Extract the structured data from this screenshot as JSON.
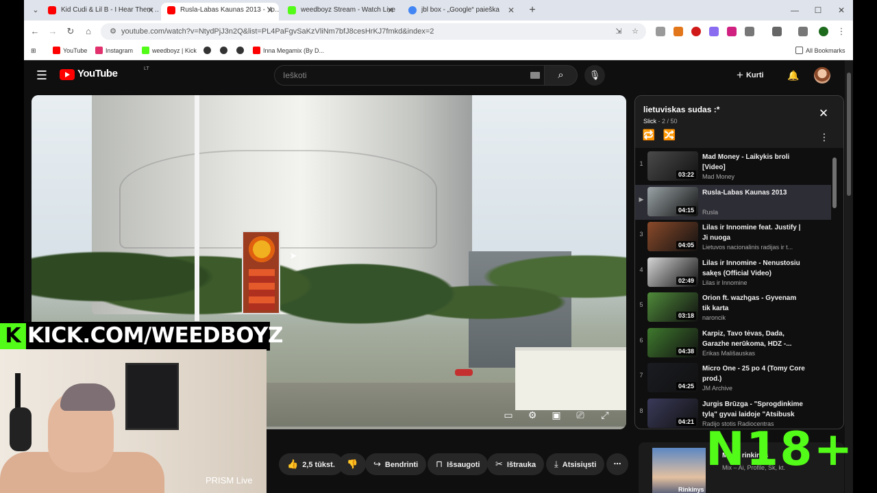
{
  "browser": {
    "tabs": [
      {
        "title": "Kid Cudi & Lil B - I Hear Them Calling",
        "favicon": "youtube-icon",
        "color": "#ff0000",
        "active": false
      },
      {
        "title": "Rusla-Labas Kaunas 2013 - YouTube",
        "favicon": "youtube-icon",
        "color": "#ff0000",
        "active": true
      },
      {
        "title": "weedboyz Stream - Watch Live",
        "favicon": "kick-icon",
        "color": "#53fc18",
        "active": false
      },
      {
        "title": "jbl box - „Google“ paieška",
        "favicon": "google-icon",
        "color": "#4285f4",
        "active": false
      }
    ],
    "url": "youtube.com/watch?v=NtydPjJ3n2Q&list=PL4PaFgvSaKzVliNm7bfJ8cesHrKJ7fmkd&index=2",
    "bookmarks": [
      {
        "label": "YouTube",
        "icon": "youtube-icon",
        "color": "#ff0000"
      },
      {
        "label": "Instagram",
        "icon": "instagram-icon",
        "color": "#e1306c"
      },
      {
        "label": "weedboyz | Kick",
        "icon": "kick-icon",
        "color": "#53fc18"
      },
      {
        "label": "",
        "icon": "globe-icon",
        "color": "#333333"
      },
      {
        "label": "",
        "icon": "globe-icon",
        "color": "#333333"
      },
      {
        "label": "",
        "icon": "globe-icon",
        "color": "#333333"
      },
      {
        "label": "Inna Megamix (By D...",
        "icon": "youtube-icon",
        "color": "#ff0000"
      }
    ],
    "all_bookmarks": "All Bookmarks"
  },
  "youtube": {
    "logo_text": "YouTube",
    "logo_country": "LT",
    "search_placeholder": "Ieškoti",
    "create_label": "Kurti",
    "actions": {
      "likes": "2,5 tūkst.",
      "share": "Bendrinti",
      "save": "Išsaugoti",
      "clip": "Ištrauka",
      "download": "Atsisiųsti"
    }
  },
  "player": {
    "progress": 0.0
  },
  "overlays": {
    "kick_text": "KICK.COM/WEEDBOYZ",
    "kick_logo": "K",
    "prism": "PRISM Live",
    "rating": "N18+"
  },
  "playlist": {
    "title": "lietuviskas sudas :*",
    "owner": "Slick",
    "position": "2 / 50",
    "items": [
      {
        "index": "1",
        "title": "Mad Money - Laikykis broli [Video]",
        "channel": "Mad Money",
        "duration": "03:22",
        "current": false,
        "thumb": "#4a4a4a"
      },
      {
        "index": "▶",
        "title": "Rusla-Labas Kaunas 2013",
        "channel": "Rusla",
        "duration": "04:15",
        "current": true,
        "thumb": "#9aa3a6"
      },
      {
        "index": "3",
        "title": "Lilas ir Innomine feat. Justify | Ji nuoga",
        "channel": "Lietuvos nacionalinis radijas ir t...",
        "duration": "04:05",
        "current": false,
        "thumb": "#8a4a2a"
      },
      {
        "index": "4",
        "title": "Lilas ir Innomine - Nenustosiu sakęs (Official Video)",
        "channel": "Lilas ir Innomine",
        "duration": "02:49",
        "current": false,
        "thumb": "#d6d6d6"
      },
      {
        "index": "5",
        "title": "Orion ft. wazhgas - Gyvenam tik karta",
        "channel": "naroncik",
        "duration": "03:18",
        "current": false,
        "thumb": "#4f8a3a"
      },
      {
        "index": "6",
        "title": "Karpiz, Tavo tėvas, Dada, Garazhe nerūkoma, HDZ -...",
        "channel": "Erikas Mališauskas",
        "duration": "04:38",
        "current": false,
        "thumb": "#3f7a2e"
      },
      {
        "index": "7",
        "title": "Micro One - 25 po 4 (Tomy Core prod.)",
        "channel": "JM Archive",
        "duration": "04:25",
        "current": false,
        "thumb": "#1a1c22"
      },
      {
        "index": "8",
        "title": "Jurgis Brūzga - \"Sprogdinkime tylą\" gyvai laidoje \"Atsibusk s...",
        "channel": "Radijo stotis Radiocentras",
        "duration": "04:21",
        "current": false,
        "thumb": "#3a3a5a"
      }
    ]
  },
  "recommended": {
    "title": "Mano rinkinys",
    "channel": "Mix – Ai, Profile, Sk, kt.",
    "label": "Rinkinys"
  }
}
